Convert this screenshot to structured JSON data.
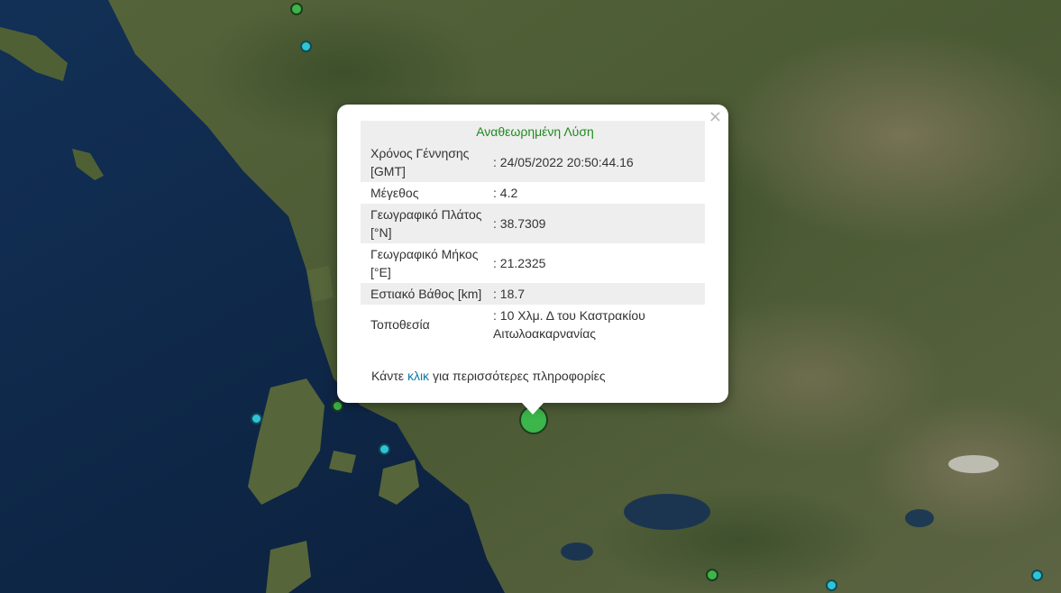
{
  "popup": {
    "title": "Αναθεωρημένη Λύση",
    "rows": [
      {
        "label": "Χρόνος Γέννησης [GMT]",
        "value": ": 24/05/2022 20:50:44.16"
      },
      {
        "label": "Μέγεθος",
        "value": ": 4.2"
      },
      {
        "label": "Γεωγραφικό Πλάτος [°N]",
        "value": ": 38.7309"
      },
      {
        "label": "Γεωγραφικό Μήκος [°E]",
        "value": ": 21.2325"
      },
      {
        "label": "Εστιακό Βάθος [km]",
        "value": ": 18.7"
      },
      {
        "label": "Τοποθεσία",
        "value": ": 10 Χλμ. Δ του Καστρακίου Αιτωλοακαρνανίας"
      }
    ],
    "more_prefix": "Κάντε",
    "more_link": "κλικ",
    "more_suffix": "για περισσότερες πληροφορίες",
    "close_glyph": "×"
  },
  "colors": {
    "sea": "#0c2340",
    "land": "#4c5a30",
    "marker_green": "#3cb54a",
    "marker_cyan": "#2ec4d6",
    "title_green": "#1f8a1f",
    "link_blue": "#0a7aa8"
  },
  "markers": [
    {
      "type": "main-event",
      "color": "green"
    },
    {
      "type": "event",
      "color": "green"
    },
    {
      "type": "event",
      "color": "cyan"
    },
    {
      "type": "event",
      "color": "cyan"
    },
    {
      "type": "event",
      "color": "green"
    },
    {
      "type": "event",
      "color": "cyan"
    },
    {
      "type": "event",
      "color": "green"
    },
    {
      "type": "event",
      "color": "cyan"
    },
    {
      "type": "event",
      "color": "cyan"
    }
  ]
}
